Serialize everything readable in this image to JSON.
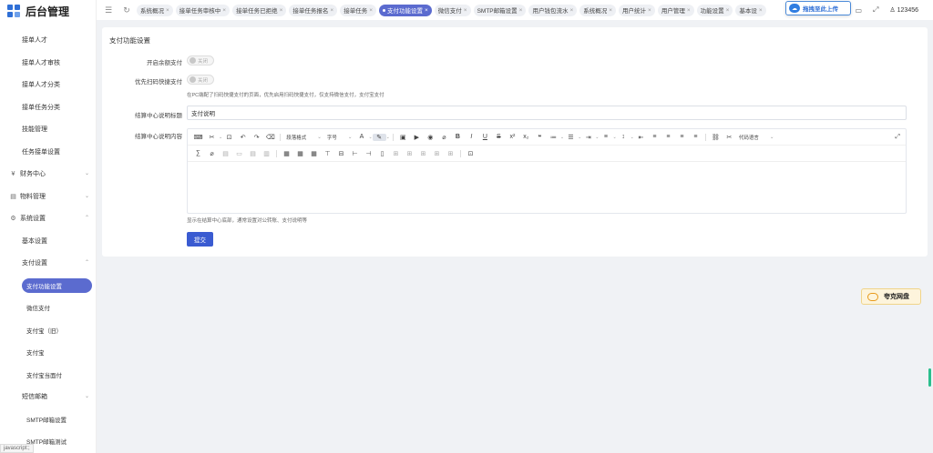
{
  "brand": {
    "title": "后台管理"
  },
  "sidebar": {
    "items": [
      {
        "label": "接单人才",
        "level": 2
      },
      {
        "label": "接单人才审核",
        "level": 2
      },
      {
        "label": "接单人才分类",
        "level": 2
      },
      {
        "label": "接单任务分类",
        "level": 2
      },
      {
        "label": "技能管理",
        "level": 2
      },
      {
        "label": "任务接单设置",
        "level": 2
      },
      {
        "label": "财务中心",
        "level": 1,
        "icon": "yen-icon",
        "glyph": "¥",
        "arrow": "⌄"
      },
      {
        "label": "物料管理",
        "level": 1,
        "icon": "document-icon",
        "glyph": "▤",
        "arrow": "⌄"
      },
      {
        "label": "系统设置",
        "level": 1,
        "icon": "settings-icon",
        "glyph": "⚙",
        "arrow": "⌃"
      },
      {
        "label": "基本设置",
        "level": 2
      },
      {
        "label": "支付设置",
        "level": 2,
        "arrow": "⌃"
      },
      {
        "label": "支付功能设置",
        "level": 3,
        "active": true
      },
      {
        "label": "微信支付",
        "level": 3
      },
      {
        "label": "支付宝（旧）",
        "level": 3
      },
      {
        "label": "支付宝",
        "level": 3
      },
      {
        "label": "支付宝当面付",
        "level": 3
      },
      {
        "label": "短信邮箱",
        "level": 2,
        "arrow": "⌄"
      },
      {
        "label": "SMTP邮箱设置",
        "level": 3
      },
      {
        "label": "SMTP邮箱测试",
        "level": 3
      }
    ]
  },
  "tabs": [
    {
      "label": "系统概况"
    },
    {
      "label": "接单任务审核中"
    },
    {
      "label": "接单任务已拒绝"
    },
    {
      "label": "接单任务报名"
    },
    {
      "label": "接单任务"
    },
    {
      "label": "支付功能设置",
      "active": true
    },
    {
      "label": "微信支付"
    },
    {
      "label": "SMTP邮箱设置"
    },
    {
      "label": "用户钱包流水"
    },
    {
      "label": "系统概况"
    },
    {
      "label": "用户统计"
    },
    {
      "label": "用户管理"
    },
    {
      "label": "功能设置"
    },
    {
      "label": "基本设"
    }
  ],
  "upload_float": {
    "label": "拖拽至此上传"
  },
  "topbar": {
    "username": "123456"
  },
  "page": {
    "title": "支付功能设置",
    "balance_pay": {
      "label": "开启余额支付",
      "state": "关闭"
    },
    "scan_pay": {
      "label": "优先扫码快捷支付",
      "state": "关闭",
      "hint": "在PC端配了扫码快捷支付的页面，优先启用扫码快捷支付，仅支持微信支付，支付宝支付"
    },
    "settle_title": {
      "label": "结算中心说明标题",
      "value": "支付说明"
    },
    "settle_content": {
      "label": "结算中心说明内容",
      "hint": "显示在结算中心底部，通常设置对公转账、支付说明等"
    },
    "submit_label": "提交"
  },
  "editor": {
    "paragraph_format": "段落格式",
    "font_size": "字号",
    "code_lang": "代码语言"
  },
  "pan_float": {
    "label": "夸克网盘"
  },
  "status_bar": {
    "text": "javascript:;"
  }
}
